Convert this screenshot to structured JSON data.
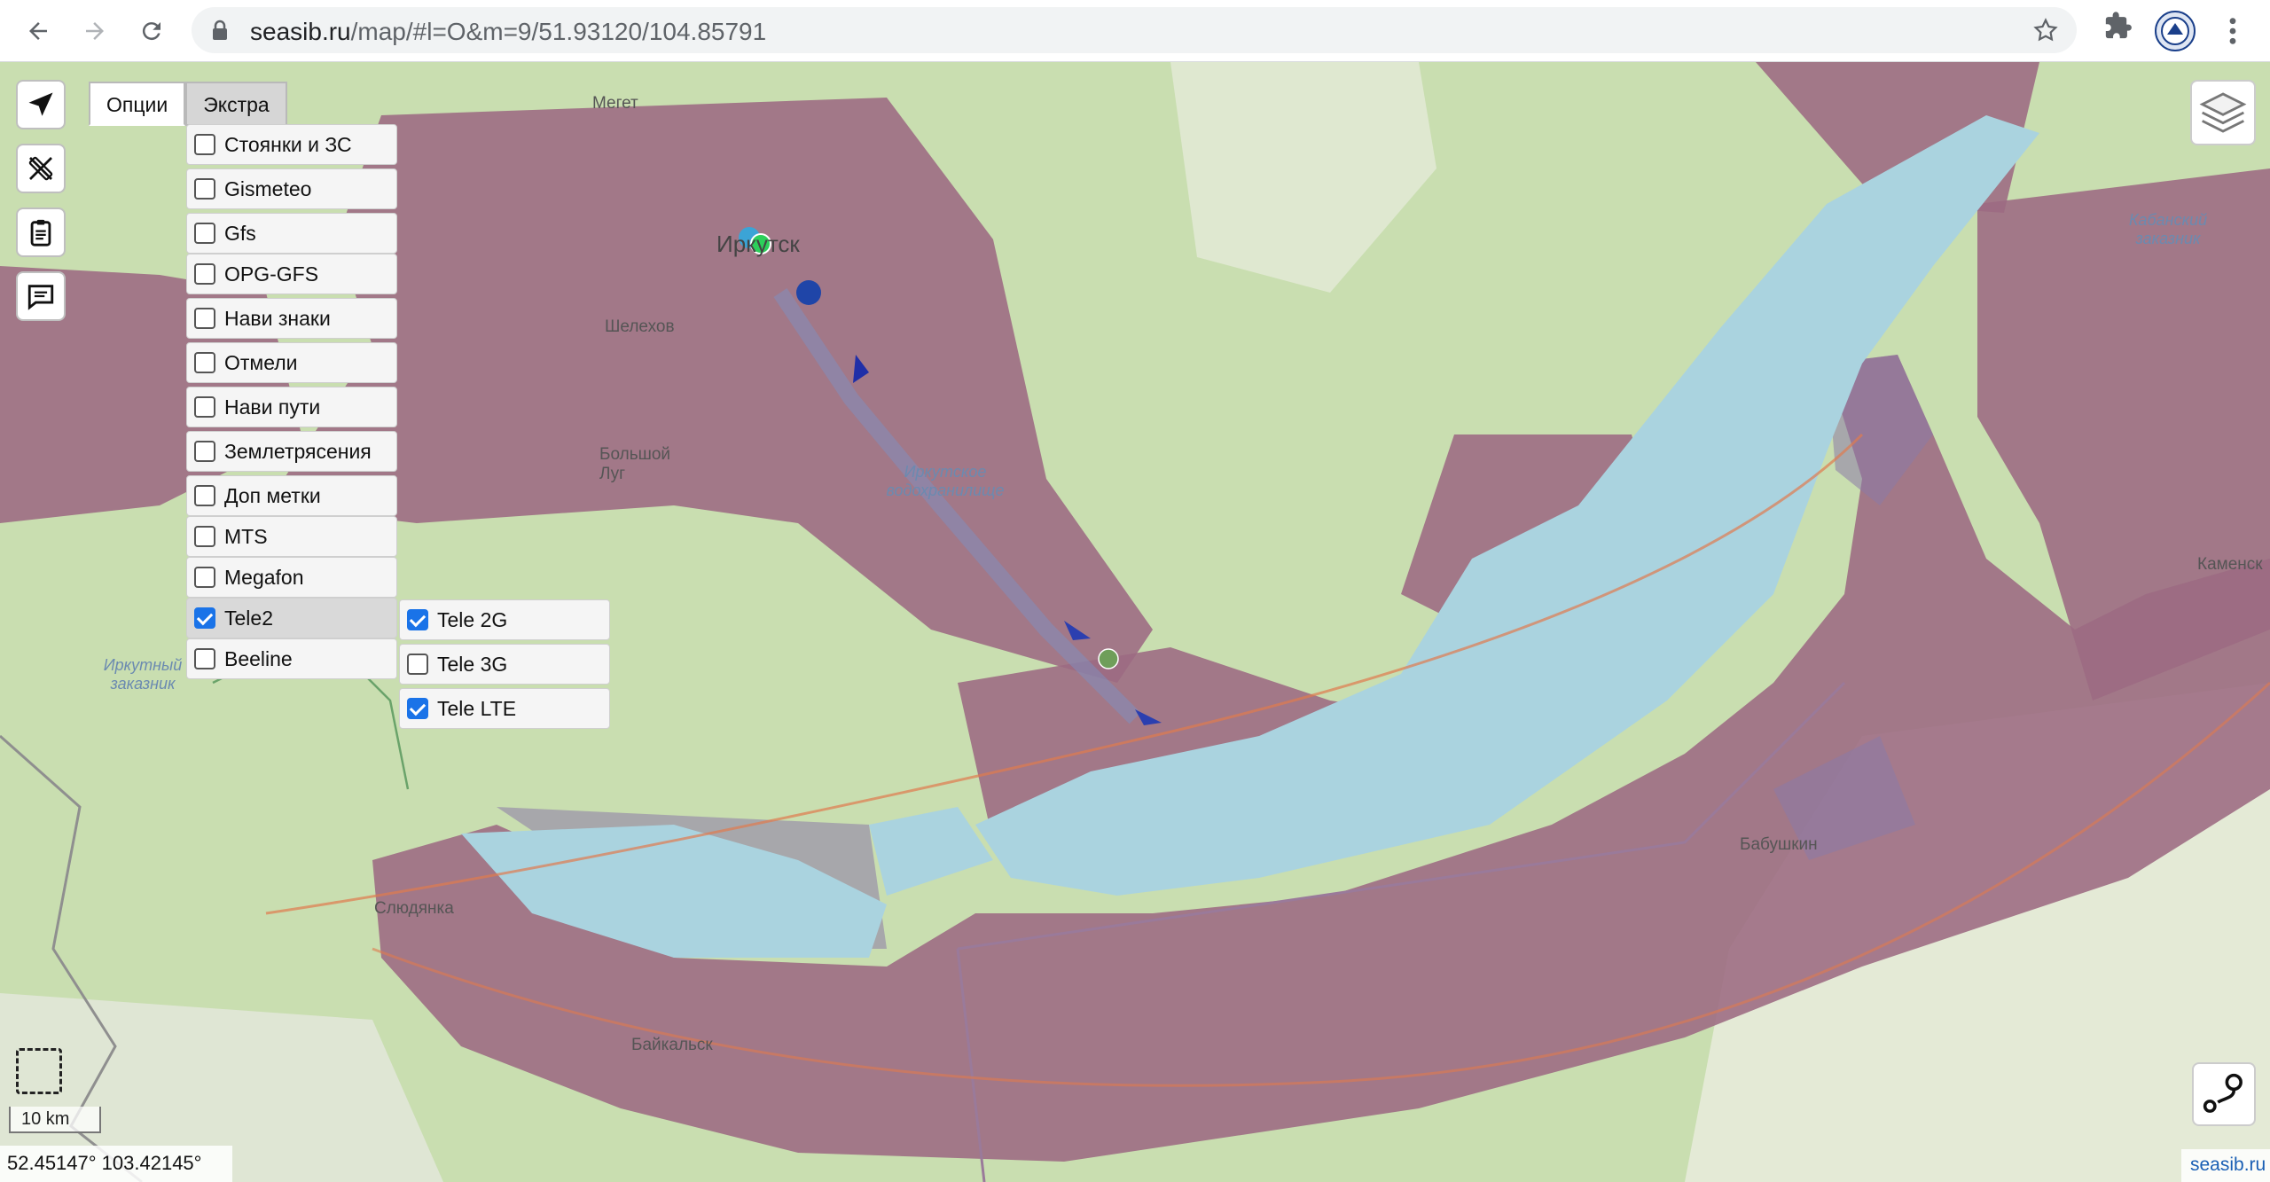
{
  "browser": {
    "url_host": "seasib.ru",
    "url_path": "/map/#l=O&m=9/51.93120/104.85791"
  },
  "tabs": [
    {
      "label": "Опции",
      "active": true
    },
    {
      "label": "Экстра",
      "active": false
    }
  ],
  "options": [
    {
      "label": "Стоянки и ЗС",
      "checked": false
    },
    {
      "label": "Gismeteo",
      "checked": false
    },
    {
      "label": "Gfs",
      "checked": false
    },
    {
      "label": "OPG-GFS",
      "checked": false
    },
    {
      "label": "Нави знаки",
      "checked": false
    },
    {
      "label": "Отмели",
      "checked": false
    },
    {
      "label": "Нави пути",
      "checked": false
    },
    {
      "label": "Землетрясения",
      "checked": false
    },
    {
      "label": "Доп метки",
      "checked": false
    },
    {
      "label": "MTS",
      "checked": false
    },
    {
      "label": "Megafon",
      "checked": false
    },
    {
      "label": "Tele2",
      "checked": true
    },
    {
      "label": "Beeline",
      "checked": false
    }
  ],
  "tele2_sub": [
    {
      "label": "Tele 2G",
      "checked": true
    },
    {
      "label": "Tele 3G",
      "checked": false
    },
    {
      "label": "Tele LTE",
      "checked": true
    }
  ],
  "places": {
    "megет": "Мегет",
    "irkutsk": "Иркутск",
    "shelekhov": "Шелехов",
    "bolshoy_lug": "Большой Луг",
    "reservoir": "Иркутское водохранилище",
    "irkutny_zakaznik": "Иркутный заказник",
    "slyudyanka": "Слюдянка",
    "baikalsk": "Байкальск",
    "babushkin": "Бабушкин",
    "kabansky": "Кабанский заказник",
    "kamensk": "Каменск"
  },
  "scale_label": "10 km",
  "coords_readout": "52.45147° 103.42145°",
  "attribution": "seasib.ru",
  "colors": {
    "land": "#c9deb0",
    "coverage": "#9c6a82",
    "lake": "#aad3df",
    "accent": "#1a73e8"
  }
}
